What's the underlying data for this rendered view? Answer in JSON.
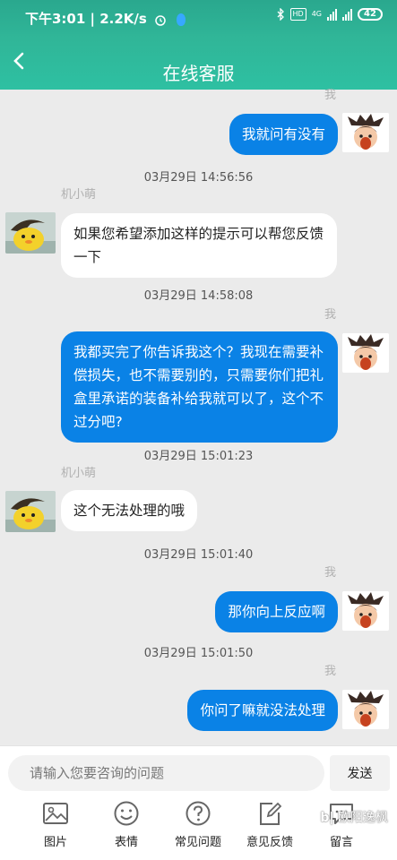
{
  "status_bar": {
    "time_speed": "下午3:01 | 2.2K/s",
    "network": "4G",
    "battery": "42"
  },
  "header": {
    "title": "在线客服"
  },
  "messages": [
    {
      "sender": "我",
      "text": "我就问有没有"
    },
    {
      "timestamp": "03月29日 14:56:56"
    },
    {
      "sender": "机小萌",
      "text": "如果您希望添加这样的提示可以帮您反馈一下"
    },
    {
      "timestamp": "03月29日 14:58:08"
    },
    {
      "sender": "我",
      "text": "我都买完了你告诉我这个？我现在需要补偿损失，也不需要别的，只需要你们把礼盒里承诺的装备补给我就可以了，这个不过分吧?"
    },
    {
      "timestamp": "03月29日 15:01:23"
    },
    {
      "sender": "机小萌",
      "text": "这个无法处理的哦"
    },
    {
      "timestamp": "03月29日 15:01:40"
    },
    {
      "sender": "我",
      "text": "那你向上反应啊"
    },
    {
      "timestamp": "03月29日 15:01:50"
    },
    {
      "sender": "我",
      "text": "你问了嘛就没法处理"
    }
  ],
  "input": {
    "placeholder": "请输入您要咨询的问题",
    "send_label": "发送"
  },
  "toolbar": [
    {
      "label": "图片",
      "icon": "image-icon"
    },
    {
      "label": "表情",
      "icon": "smile-icon"
    },
    {
      "label": "常见问题",
      "icon": "question-icon"
    },
    {
      "label": "意见反馈",
      "icon": "edit-icon"
    },
    {
      "label": "留言",
      "icon": "message-icon"
    }
  ],
  "watermark": "欧阳逸枫",
  "colors": {
    "header": "#2fb497",
    "my_bubble": "#0a82e6",
    "other_bubble": "#ffffff",
    "background": "#ebebeb"
  }
}
